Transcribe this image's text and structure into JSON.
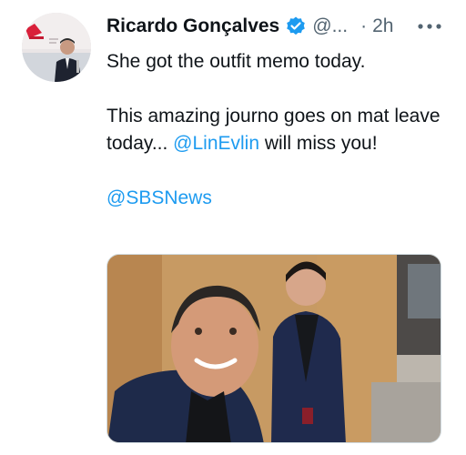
{
  "tweet": {
    "author": {
      "display_name": "Ricardo Gonçalves",
      "handle": "@...",
      "avatar_icon": "avatar-photo",
      "verified_icon": "verified-badge-icon"
    },
    "separator": "·",
    "timestamp": "2h",
    "more_icon": "more-options-icon",
    "text": {
      "line1": "She got the outfit memo today.",
      "line2_prefix": "This amazing journo goes on mat leave today... ",
      "mention": "@LinEvlin",
      "line2_suffix": " will miss you!",
      "hashtag_link": "@SBSNews"
    },
    "media": {
      "type": "photo"
    }
  },
  "colors": {
    "link": "#1d9bf0",
    "verified": "#1d9bf0",
    "secondary_text": "#536471",
    "primary_text": "#0f1419"
  }
}
